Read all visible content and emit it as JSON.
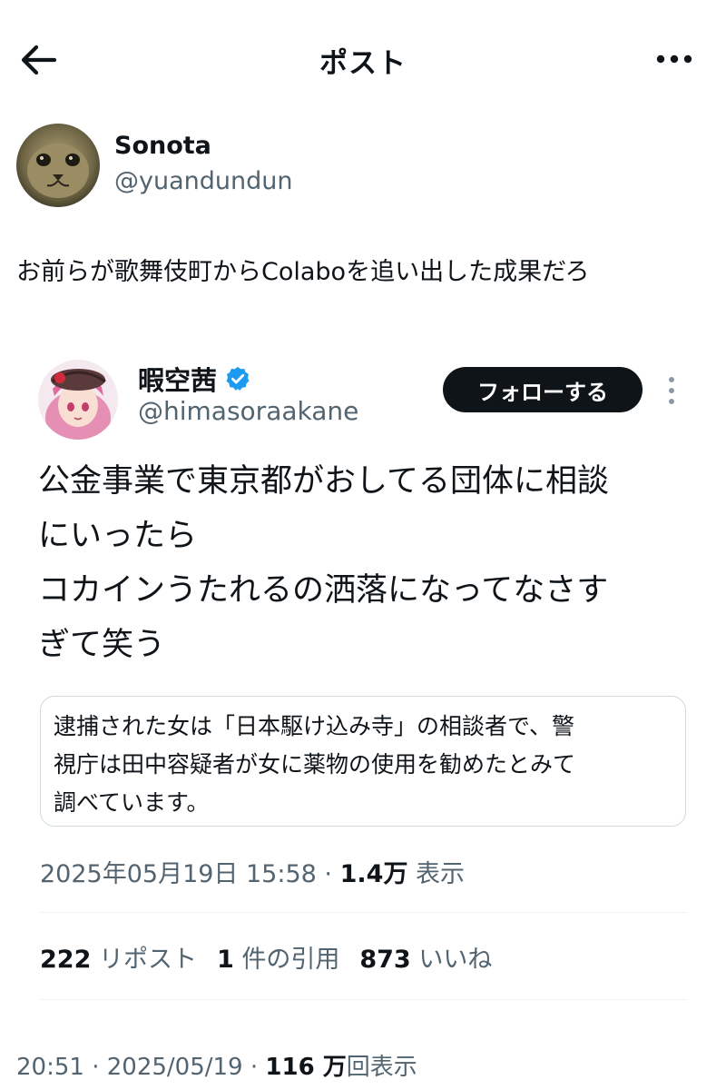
{
  "header": {
    "title": "ポスト",
    "back_icon": "arrow-left-icon",
    "more_icon": "more-horizontal-icon"
  },
  "post": {
    "author": {
      "name": "Sonota",
      "handle": "@yuandundun",
      "avatar_icon": "cat-avatar"
    },
    "text": "お前らが歌舞伎町からColaboを追い出した成果だろ",
    "quoted": {
      "author": {
        "name": "暇空茜",
        "handle": "@himasoraakane",
        "verified": true,
        "avatar_icon": "anime-girl-avatar"
      },
      "follow_label": "フォローする",
      "text_lines": [
        "公金事業で東京都がおしてる団体に相談",
        "にいったら",
        "コカインうたれるの洒落になってなさす",
        "ぎて笑う"
      ],
      "quote_box_lines": [
        "逮捕された女は「日本駆け込み寺」の相談者で、警",
        "視庁は田中容疑者が女に薬物の使用を勧めたとみて",
        "調べています。"
      ],
      "meta": {
        "datetime": "2025年05月19日 15:58",
        "separator": "·",
        "views_count": "1.4万",
        "views_label": "表示"
      },
      "stats": {
        "reposts_count": "222",
        "reposts_label": "リポスト",
        "quotes_count": "1",
        "quotes_label": "件の引用",
        "likes_count": "873",
        "likes_label": "いいね"
      }
    },
    "meta": {
      "time": "20:51",
      "separator": "·",
      "date": "2025/05/19",
      "separator2": "·",
      "views_count": "116 万",
      "views_label": "回表示"
    }
  },
  "colors": {
    "text": "#0f1419",
    "secondary": "#536471",
    "verified": "#1d9bf0",
    "border": "#cfd9de"
  }
}
